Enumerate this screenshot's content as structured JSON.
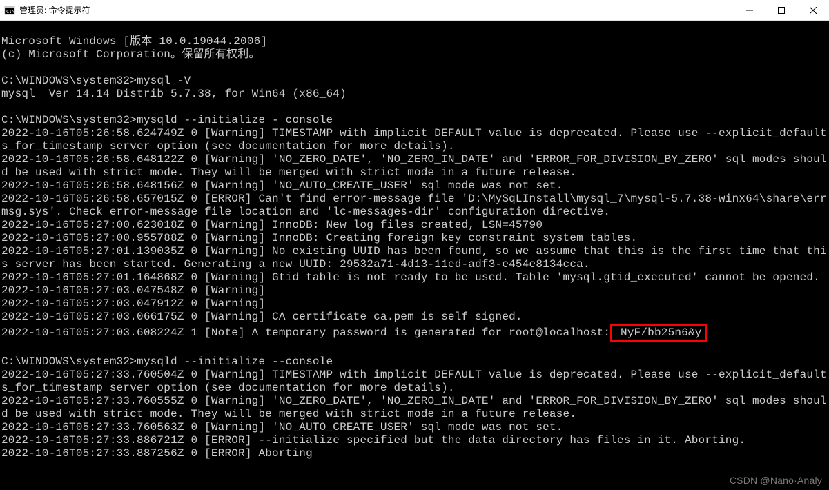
{
  "window": {
    "title": "管理员: 命令提示符"
  },
  "console": {
    "l01": "Microsoft Windows [版本 10.0.19044.2006]",
    "l02": "(c) Microsoft Corporation。保留所有权利。",
    "blank1": "",
    "l03a": "C:\\WINDOWS\\system32>",
    "l03b": "mysql -V",
    "l04": "mysql  Ver 14.14 Distrib 5.7.38, for Win64 (x86_64)",
    "blank2": "",
    "l05a": "C:\\WINDOWS\\system32>",
    "l05b": "mysqld --initialize - console",
    "l06": "2022-10-16T05:26:58.624749Z 0 [Warning] TIMESTAMP with implicit DEFAULT value is deprecated. Please use --explicit_defaults_for_timestamp server option (see documentation for more details).",
    "l07": "2022-10-16T05:26:58.648122Z 0 [Warning] 'NO_ZERO_DATE', 'NO_ZERO_IN_DATE' and 'ERROR_FOR_DIVISION_BY_ZERO' sql modes should be used with strict mode. They will be merged with strict mode in a future release.",
    "l08": "2022-10-16T05:26:58.648156Z 0 [Warning] 'NO_AUTO_CREATE_USER' sql mode was not set.",
    "l09": "2022-10-16T05:26:58.657015Z 0 [ERROR] Can't find error-message file 'D:\\MySqLInstall\\mysql_7\\mysql-5.7.38-winx64\\share\\errmsg.sys'. Check error-message file location and 'lc-messages-dir' configuration directive.",
    "l10": "2022-10-16T05:27:00.623018Z 0 [Warning] InnoDB: New log files created, LSN=45790",
    "l11": "2022-10-16T05:27:00.955788Z 0 [Warning] InnoDB: Creating foreign key constraint system tables.",
    "l12": "2022-10-16T05:27:01.139035Z 0 [Warning] No existing UUID has been found, so we assume that this is the first time that this server has been started. Generating a new UUID: 29532a71-4d13-11ed-adf3-e454e8134cca.",
    "l13": "2022-10-16T05:27:01.164868Z 0 [Warning] Gtid table is not ready to be used. Table 'mysql.gtid_executed' cannot be opened.",
    "l14": "2022-10-16T05:27:03.047548Z 0 [Warning]",
    "l15": "2022-10-16T05:27:03.047912Z 0 [Warning]",
    "l16": "2022-10-16T05:27:03.066175Z 0 [Warning] CA certificate ca.pem is self signed.",
    "l17a": "2022-10-16T05:27:03.608224Z 1 [Note] A temporary password is generated for root@localhost:",
    "l17b": " NyF/bb25n6&y",
    "blank3": "",
    "l18a": "C:\\WINDOWS\\system32>",
    "l18b": "mysqld --initialize --console",
    "l19": "2022-10-16T05:27:33.760504Z 0 [Warning] TIMESTAMP with implicit DEFAULT value is deprecated. Please use --explicit_defaults_for_timestamp server option (see documentation for more details).",
    "l20": "2022-10-16T05:27:33.760555Z 0 [Warning] 'NO_ZERO_DATE', 'NO_ZERO_IN_DATE' and 'ERROR_FOR_DIVISION_BY_ZERO' sql modes should be used with strict mode. They will be merged with strict mode in a future release.",
    "l21": "2022-10-16T05:27:33.760563Z 0 [Warning] 'NO_AUTO_CREATE_USER' sql mode was not set.",
    "l22": "2022-10-16T05:27:33.886721Z 0 [ERROR] --initialize specified but the data directory has files in it. Aborting.",
    "l23": "2022-10-16T05:27:33.887256Z 0 [ERROR] Aborting"
  },
  "watermark": "CSDN @Nano·Analy"
}
